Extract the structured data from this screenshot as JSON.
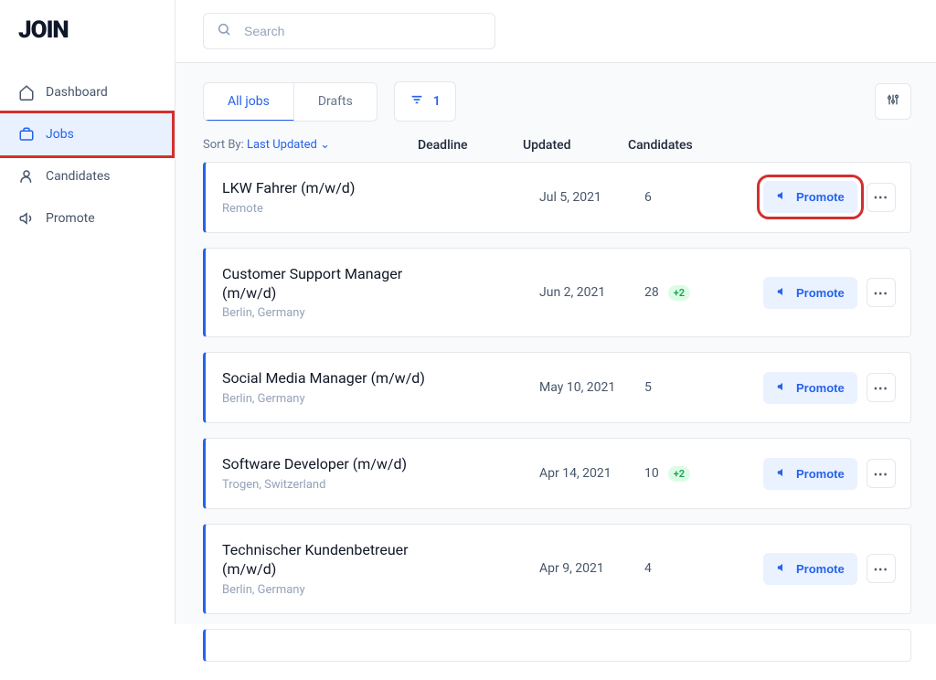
{
  "logo": "JOIN",
  "search": {
    "placeholder": "Search"
  },
  "sidebar": {
    "items": [
      {
        "label": "Dashboard"
      },
      {
        "label": "Jobs"
      },
      {
        "label": "Candidates"
      },
      {
        "label": "Promote"
      }
    ]
  },
  "tabs": {
    "all": "All jobs",
    "drafts": "Drafts"
  },
  "filter_count": "1",
  "sort": {
    "label": "Sort By:",
    "value": "Last Updated"
  },
  "columns": {
    "deadline": "Deadline",
    "updated": "Updated",
    "candidates": "Candidates"
  },
  "promote_label": "Promote",
  "jobs": [
    {
      "title": "LKW Fahrer (m/w/d)",
      "location": "Remote",
      "deadline": "",
      "updated": "Jul 5, 2021",
      "candidates": "6",
      "delta": ""
    },
    {
      "title": "Customer Support Manager (m/w/d)",
      "location": "Berlin, Germany",
      "deadline": "",
      "updated": "Jun 2, 2021",
      "candidates": "28",
      "delta": "+2"
    },
    {
      "title": "Social Media Manager (m/w/d)",
      "location": "Berlin, Germany",
      "deadline": "",
      "updated": "May 10, 2021",
      "candidates": "5",
      "delta": ""
    },
    {
      "title": "Software Developer (m/w/d)",
      "location": "Trogen, Switzerland",
      "deadline": "",
      "updated": "Apr 14, 2021",
      "candidates": "10",
      "delta": "+2"
    },
    {
      "title": "Technischer Kundenbetreuer (m/w/d)",
      "location": "Berlin, Germany",
      "deadline": "",
      "updated": "Apr 9, 2021",
      "candidates": "4",
      "delta": ""
    }
  ]
}
